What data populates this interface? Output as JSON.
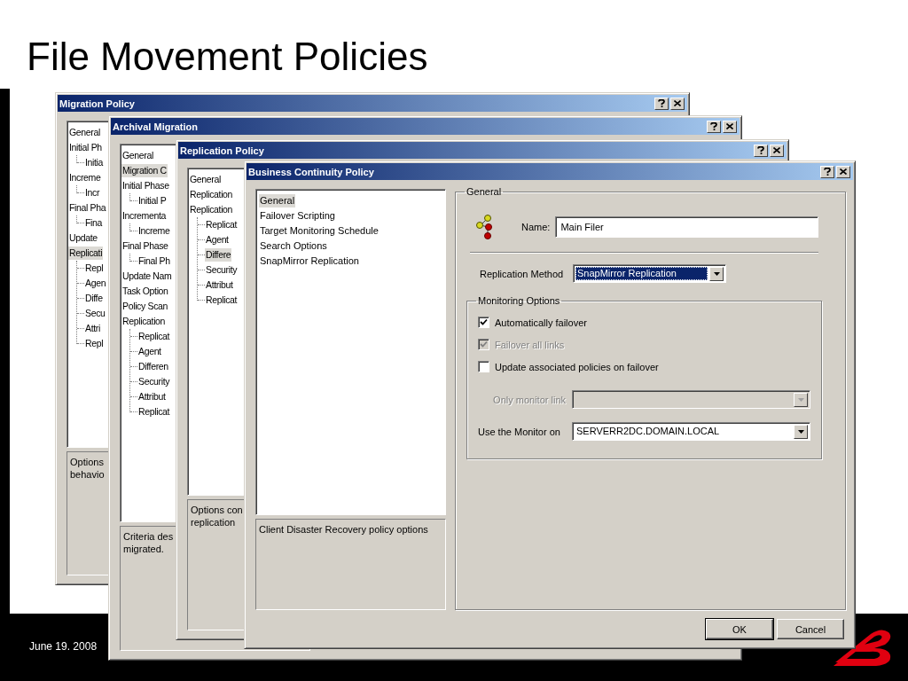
{
  "slide": {
    "title": "File Movement Policies",
    "footer_date": "June 19. 2008"
  },
  "dialogs": [
    {
      "title": "Migration Policy",
      "tree": [
        {
          "label": "General",
          "selected": false
        },
        {
          "label": "Initial Ph",
          "selected": false,
          "children": [
            {
              "label": "Initia",
              "selected": false
            }
          ]
        },
        {
          "label": "Increme",
          "selected": false,
          "children": [
            {
              "label": "Incr",
              "selected": false
            }
          ]
        },
        {
          "label": "Final Pha",
          "selected": false,
          "children": [
            {
              "label": "Fina",
              "selected": false
            }
          ]
        },
        {
          "label": "Update",
          "selected": false
        },
        {
          "label": "Replicati",
          "selected": true,
          "children": [
            {
              "label": "Repl",
              "selected": false
            },
            {
              "label": "Agen",
              "selected": false
            },
            {
              "label": "Diffe",
              "selected": false
            },
            {
              "label": "Secu",
              "selected": false
            },
            {
              "label": "Attri",
              "selected": false
            },
            {
              "label": "Repl",
              "selected": false
            }
          ]
        }
      ],
      "description": [
        "Options",
        "behavio"
      ]
    },
    {
      "title": "Archival Migration",
      "tree": [
        {
          "label": "General",
          "selected": false
        },
        {
          "label": "Migration C",
          "selected": true
        },
        {
          "label": "Initial Phase",
          "selected": false,
          "children": [
            {
              "label": "Initial P",
              "selected": false
            }
          ]
        },
        {
          "label": "Incrementa",
          "selected": false,
          "children": [
            {
              "label": "Increme",
              "selected": false
            }
          ]
        },
        {
          "label": "Final Phase",
          "selected": false,
          "children": [
            {
              "label": "Final Ph",
              "selected": false
            }
          ]
        },
        {
          "label": "Update Nam",
          "selected": false
        },
        {
          "label": "Task Option",
          "selected": false
        },
        {
          "label": "Policy Scan",
          "selected": false
        },
        {
          "label": "Replication",
          "selected": false,
          "children": [
            {
              "label": "Replicat",
              "selected": false
            },
            {
              "label": "Agent",
              "selected": false
            },
            {
              "label": "Differen",
              "selected": false
            },
            {
              "label": "Security",
              "selected": false
            },
            {
              "label": "Attribut",
              "selected": false
            },
            {
              "label": "Replicat",
              "selected": false
            }
          ]
        }
      ],
      "description": [
        "Criteria des",
        "migrated."
      ]
    },
    {
      "title": "Replication Policy",
      "tree": [
        {
          "label": "General",
          "selected": false
        },
        {
          "label": "Replication",
          "selected": false
        },
        {
          "label": "Replication",
          "selected": false,
          "children": [
            {
              "label": "Replicat",
              "selected": false
            },
            {
              "label": "Agent",
              "selected": false
            },
            {
              "label": "Differe",
              "selected": true
            },
            {
              "label": "Security",
              "selected": false
            },
            {
              "label": "Attribut",
              "selected": false
            },
            {
              "label": "Replicat",
              "selected": false
            }
          ]
        }
      ],
      "description": [
        "Options con",
        "replication"
      ]
    },
    {
      "title": "Business Continuity Policy",
      "tree": [
        {
          "label": "General",
          "selected": true
        },
        {
          "label": "Failover Scripting",
          "selected": false
        },
        {
          "label": "Target Monitoring Schedule",
          "selected": false
        },
        {
          "label": "Search Options",
          "selected": false
        },
        {
          "label": "SnapMirror Replication",
          "selected": false
        }
      ],
      "description": [
        "Client Disaster Recovery policy options"
      ],
      "settings": {
        "group_title": "General",
        "name_label": "Name:",
        "name_value": "Main Filer",
        "method": {
          "label": "Replication Method",
          "value": "SnapMirror Replication",
          "highlighted": true
        },
        "monitoring": {
          "title": "Monitoring Options",
          "checkboxes": [
            {
              "label": "Automatically failover",
              "checked": true,
              "disabled": false
            },
            {
              "label": "Failover all links",
              "checked": true,
              "disabled": true
            },
            {
              "label": "Update associated policies on failover",
              "checked": false,
              "disabled": false
            }
          ],
          "dropdowns": [
            {
              "label": "Only monitor link",
              "disabled": true
            },
            {
              "label": "Use the Monitor on",
              "value": "SERVERR2DC.DOMAIN.LOCAL",
              "disabled": false
            }
          ]
        }
      },
      "buttons": [
        "OK",
        "Cancel"
      ]
    }
  ]
}
